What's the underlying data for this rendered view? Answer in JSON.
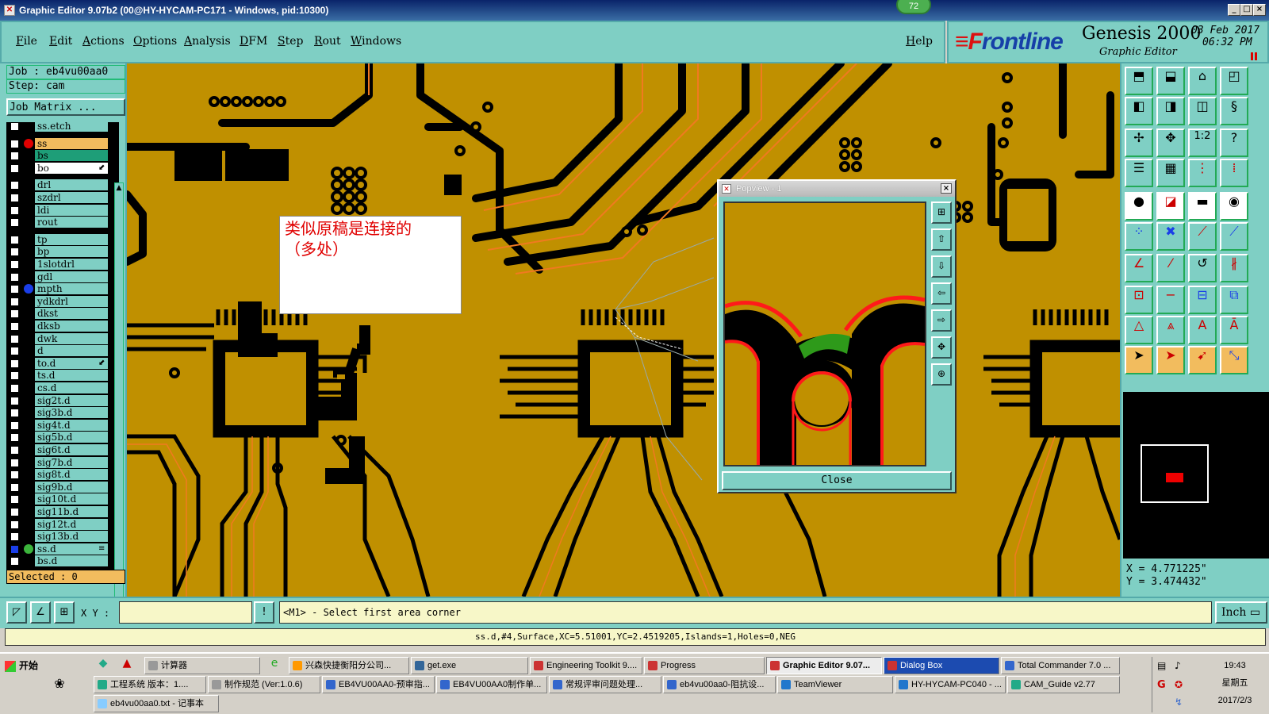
{
  "window": {
    "title": "Graphic Editor 9.07b2 (00@HY-HYCAM-PC171 - Windows, pid:10300)",
    "badge": "72",
    "min_glyph": "_",
    "max_glyph": "□",
    "close_glyph": "×"
  },
  "menu": [
    "File",
    "Edit",
    "Actions",
    "Options",
    "Analysis",
    "DFM",
    "Step",
    "Rout",
    "Windows"
  ],
  "help_label": "Help",
  "brand": {
    "logo_prefix": "F",
    "logo_rest": "rontline",
    "product": "Genesis 2000",
    "subtitle": "Graphic Editor",
    "date": "03 Feb 2017",
    "time": "06:32 PM"
  },
  "job": {
    "job_label": "Job : eb4vu00aa0",
    "step_label": "Step: cam",
    "matrix_button": "Job Matrix ..."
  },
  "layers": [
    {
      "name": "ss.etch",
      "color": "#7fcfc4",
      "dot": ""
    },
    {
      "name": "ss",
      "color": "#f2bc5e",
      "dot": "#e00000"
    },
    {
      "name": "bs",
      "color": "#1e9e78",
      "dot": ""
    },
    {
      "name": "bo",
      "color": "#ffffff",
      "dot": "",
      "mark": "⬋"
    },
    {
      "name": "drl",
      "color": "#7fcfc4",
      "dot": ""
    },
    {
      "name": "szdrl",
      "color": "#7fcfc4",
      "dot": ""
    },
    {
      "name": "ldi",
      "color": "#7fcfc4",
      "dot": ""
    },
    {
      "name": "rout",
      "color": "#7fcfc4",
      "dot": ""
    },
    {
      "name": "tp",
      "color": "#7fcfc4",
      "dot": ""
    },
    {
      "name": "bp",
      "color": "#7fcfc4",
      "dot": ""
    },
    {
      "name": "1slotdrl",
      "color": "#7fcfc4",
      "dot": ""
    },
    {
      "name": "gdl",
      "color": "#7fcfc4",
      "dot": ""
    },
    {
      "name": "mpth",
      "color": "#7fcfc4",
      "dot": "#1a3ee8"
    },
    {
      "name": "ydkdrl",
      "color": "#7fcfc4",
      "dot": ""
    },
    {
      "name": "dkst",
      "color": "#7fcfc4",
      "dot": ""
    },
    {
      "name": "dksb",
      "color": "#7fcfc4",
      "dot": ""
    },
    {
      "name": "dwk",
      "color": "#7fcfc4",
      "dot": ""
    },
    {
      "name": "d",
      "color": "#7fcfc4",
      "dot": ""
    },
    {
      "name": "to.d",
      "color": "#7fcfc4",
      "dot": "",
      "mark": "⬋"
    },
    {
      "name": "ts.d",
      "color": "#7fcfc4",
      "dot": ""
    },
    {
      "name": "cs.d",
      "color": "#7fcfc4",
      "dot": ""
    },
    {
      "name": "sig2t.d",
      "color": "#7fcfc4",
      "dot": ""
    },
    {
      "name": "sig3b.d",
      "color": "#7fcfc4",
      "dot": ""
    },
    {
      "name": "sig4t.d",
      "color": "#7fcfc4",
      "dot": ""
    },
    {
      "name": "sig5b.d",
      "color": "#7fcfc4",
      "dot": ""
    },
    {
      "name": "sig6t.d",
      "color": "#7fcfc4",
      "dot": ""
    },
    {
      "name": "sig7b.d",
      "color": "#7fcfc4",
      "dot": ""
    },
    {
      "name": "sig8t.d",
      "color": "#7fcfc4",
      "dot": ""
    },
    {
      "name": "sig9b.d",
      "color": "#7fcfc4",
      "dot": ""
    },
    {
      "name": "sig10t.d",
      "color": "#7fcfc4",
      "dot": ""
    },
    {
      "name": "sig11b.d",
      "color": "#7fcfc4",
      "dot": ""
    },
    {
      "name": "sig12t.d",
      "color": "#7fcfc4",
      "dot": ""
    },
    {
      "name": "sig13b.d",
      "color": "#7fcfc4",
      "dot": ""
    },
    {
      "name": "ss.d",
      "color": "#7fcfc4",
      "dot": "#3cb43c",
      "mark": "≡"
    },
    {
      "name": "bs.d",
      "color": "#7fcfc4",
      "dot": ""
    }
  ],
  "selected_label": "Selected : 0",
  "annotation": {
    "line1": "类似原稿是连接的",
    "line2": "（多处）"
  },
  "popview": {
    "title": "Popview - 1",
    "close_label": "Close"
  },
  "coords": {
    "x": "X = 4.771225\"",
    "y": "Y = 3.474432\""
  },
  "bottom": {
    "xy_label": "X Y :",
    "prompt": "<M1> - Select first area corner",
    "unit": "Inch ▭"
  },
  "status": "ss.d,#4,Surface,XC=5.51001,YC=2.4519205,Islands=1,Holes=0,NEG",
  "taskbar": {
    "start": "开始",
    "row1": [
      "计算器",
      "兴森快捷衡阳分公司...",
      "get.exe",
      "Engineering Toolkit 9....",
      "Progress",
      "Graphic Editor 9.07...",
      "Dialog Box",
      "Total Commander 7.0 ..."
    ],
    "row2": [
      "工程系统  版本：1....",
      "制作规范 (Ver:1.0.6)",
      "EB4VU00AA0-预审指...",
      "EB4VU00AA0制作单...",
      "常规评审问题处理...",
      "eb4vu00aa0-阻抗设...",
      "TeamViewer",
      "HY-HYCAM-PC040 - ...",
      "CAM_Guide v2.77"
    ],
    "row3": [
      "eb4vu00aa0.txt - 记事本"
    ],
    "clock_time": "19:43",
    "clock_day": "星期五",
    "clock_date": "2017/2/3"
  },
  "colors": {
    "panel": "#7fcfc4",
    "board": "#c09000",
    "copper_outline": "#000000",
    "highlight_red": "#ff1a1a",
    "highlight_green": "#2e9a1a"
  }
}
